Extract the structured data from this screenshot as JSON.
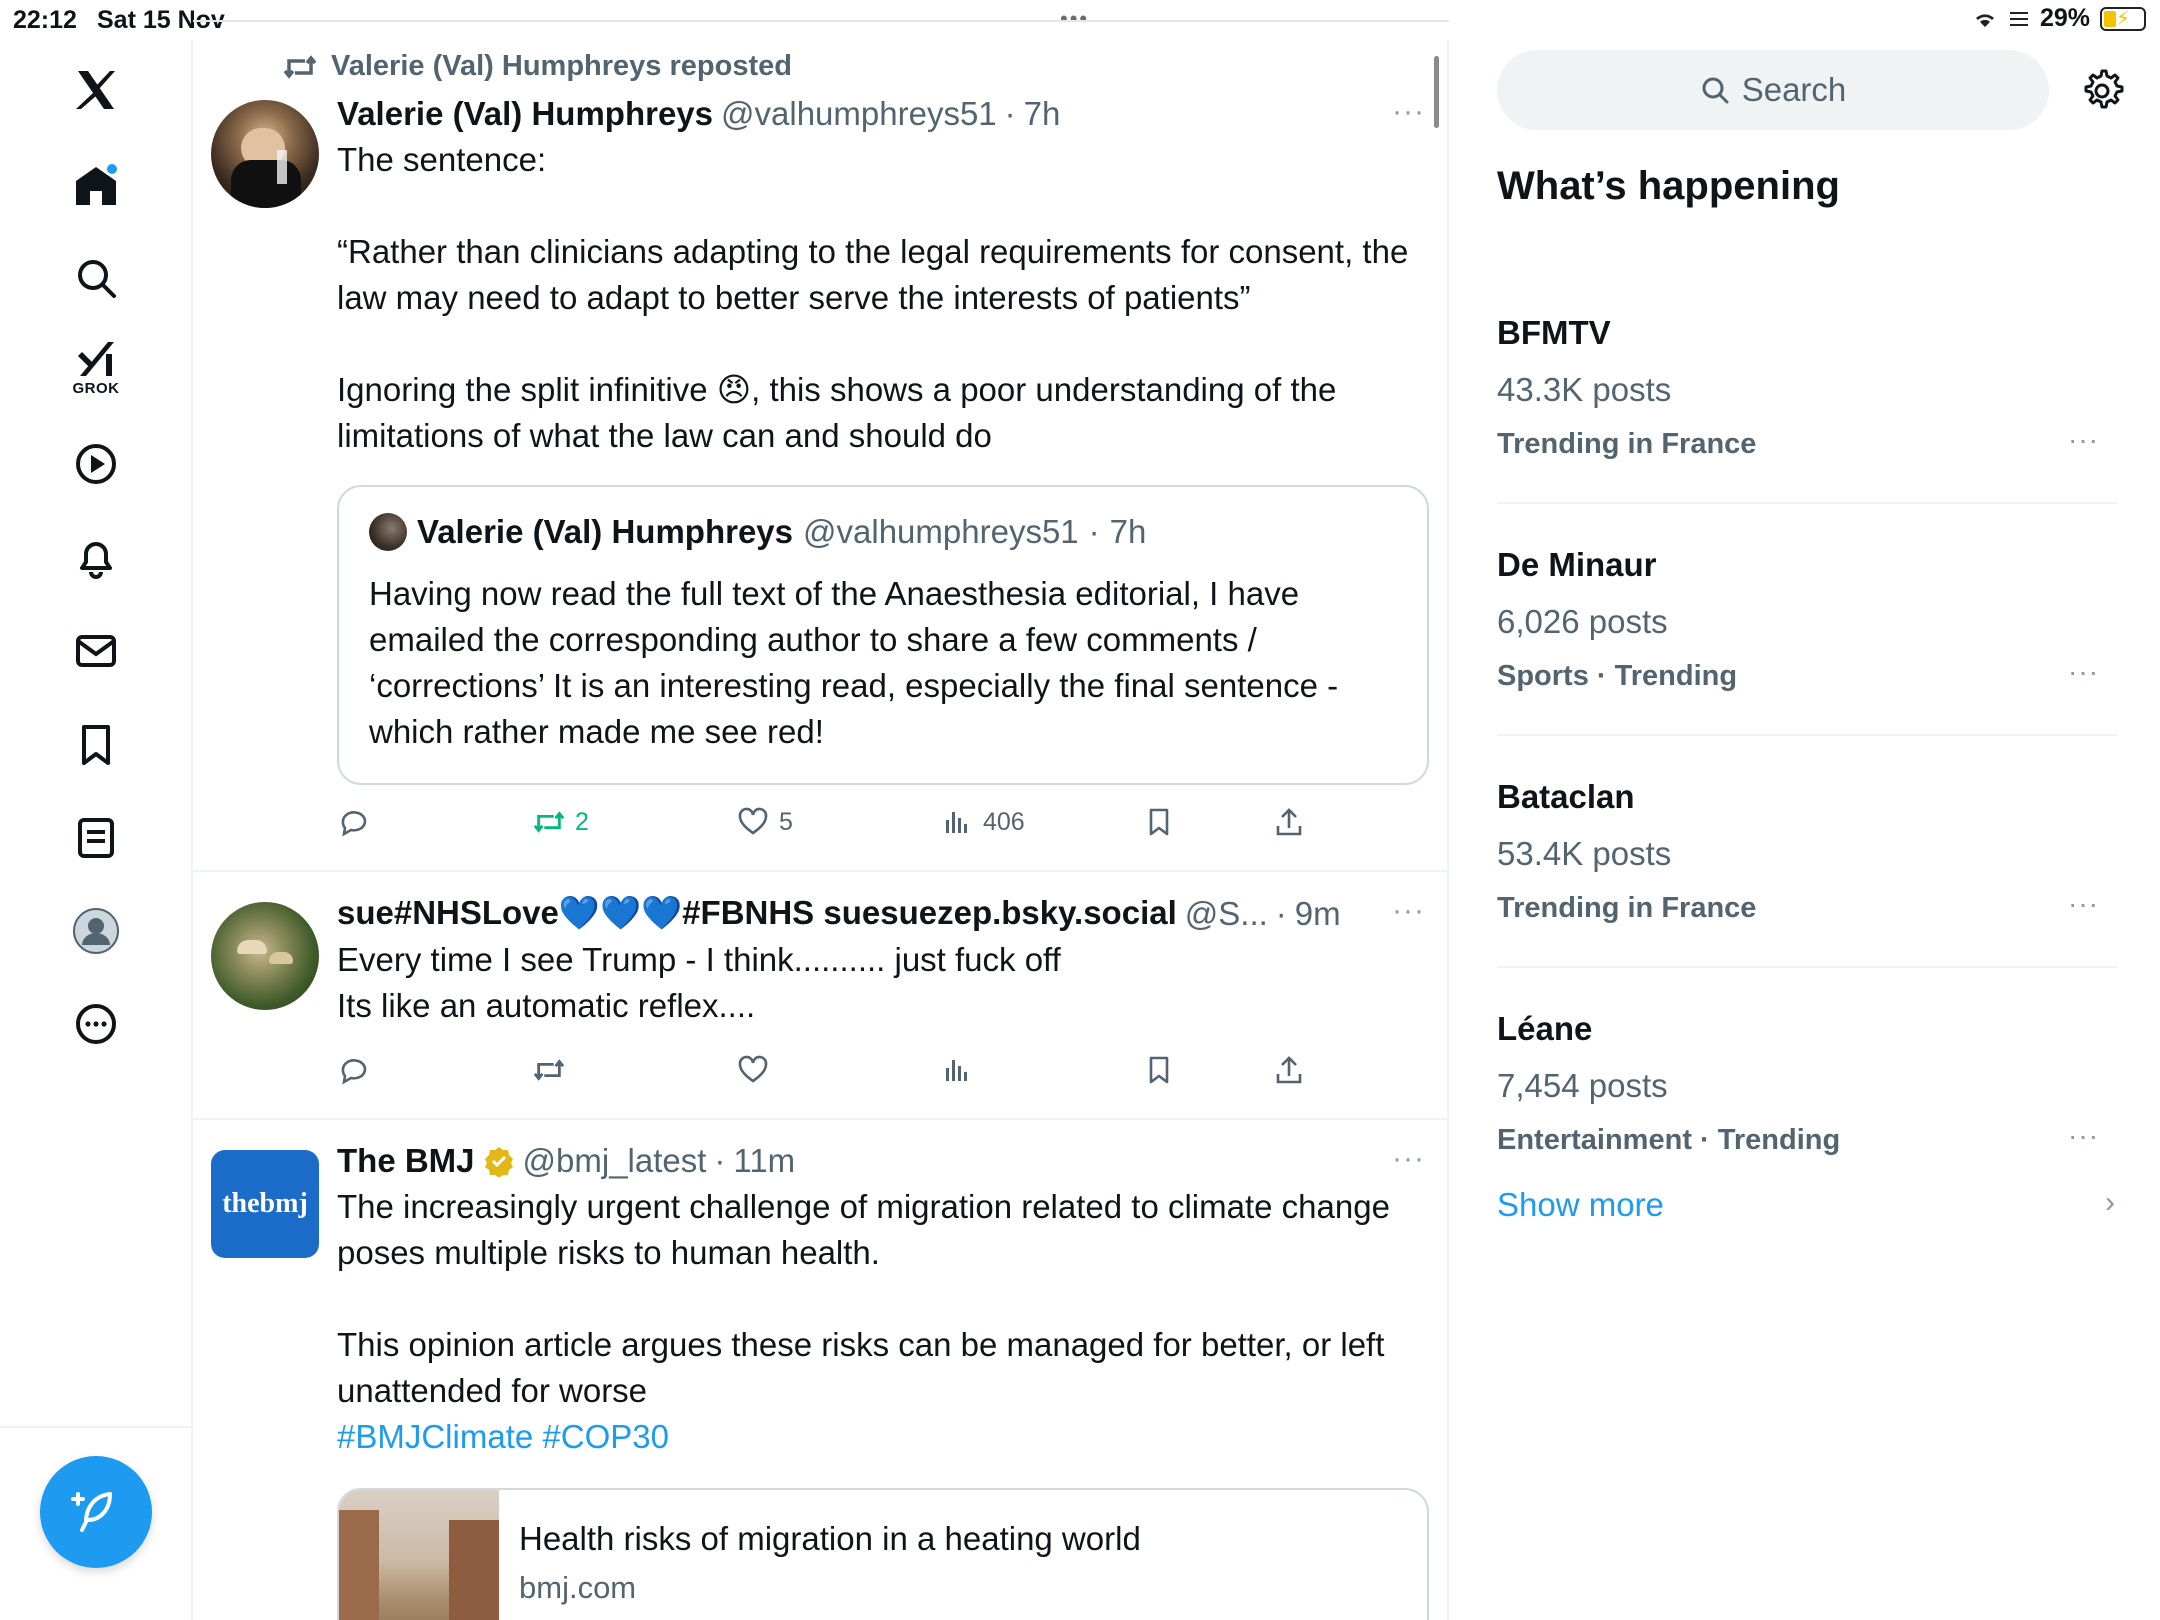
{
  "status_bar": {
    "time": "22:12",
    "date": "Sat 15 Nov",
    "battery": "29%",
    "multitask_dots": "•••"
  },
  "nav": {
    "items": [
      "x-logo",
      "home",
      "search",
      "grok",
      "video",
      "notifications",
      "messages",
      "bookmarks",
      "lists",
      "profile",
      "more"
    ],
    "grok_label": "GROK"
  },
  "posts": [
    {
      "repost_label": "Valerie (Val) Humphreys reposted",
      "name": "Valerie (Val) Humphreys",
      "handle": "@valhumphreys51",
      "sep": "·",
      "time": "7h",
      "text": "The sentence:\n\n“Rather than clinicians adapting to the legal requirements for consent, the law may need to adapt to better serve the interests of patients”\n\nIgnoring the split infinitive 😠, this shows a poor understanding of the limitations of what the law can and should do",
      "quote": {
        "name": "Valerie (Val) Humphreys",
        "handle": "@valhumphreys51",
        "sep": "·",
        "time": "7h",
        "text": "Having now read the full text of the Anaesthesia editorial, I have emailed the corresponding author to share a few comments / ‘corrections’ It is an interesting read, especially the final sentence - which rather made me see red!"
      },
      "reposts": "2",
      "likes": "5",
      "views": "406"
    },
    {
      "name": "sue#NHSLove💙💙💙#FBNHS suesuezep.bsky.social",
      "handle": "@S...",
      "sep": "·",
      "time": "9m",
      "text": "Every time I see Trump - I think.......... just fuck off\nIts like an automatic reflex...."
    },
    {
      "name": "The BMJ",
      "verified": true,
      "handle": "@bmj_latest",
      "sep": "·",
      "time": "11m",
      "avatar_text": "thebmj",
      "text": "The increasingly urgent challenge of migration related to climate change poses multiple risks to human health.\n\nThis opinion article argues these risks can be managed for better, or left unattended for worse",
      "hashtags": "#BMJClimate #COP30",
      "link": {
        "title": "Health risks of migration in a heating world",
        "domain": "bmj.com"
      }
    }
  ],
  "right": {
    "search_placeholder": "Search",
    "title": "What’s happening",
    "trends": [
      {
        "name": "BFMTV",
        "count": "43.3K posts",
        "context": "Trending in France"
      },
      {
        "name": "De Minaur",
        "count": "6,026 posts",
        "context": "Sports · Trending"
      },
      {
        "name": "Bataclan",
        "count": "53.4K posts",
        "context": "Trending in France"
      },
      {
        "name": "Léane",
        "count": "7,454 posts",
        "context": "Entertainment · Trending"
      }
    ],
    "show_more": "Show more",
    "more_glyph": "···"
  },
  "colors": {
    "accent": "#1d9bf0",
    "repost_green": "#00ba7c",
    "secondary_text": "#536471",
    "bmj_blue": "#1a6cc8"
  }
}
